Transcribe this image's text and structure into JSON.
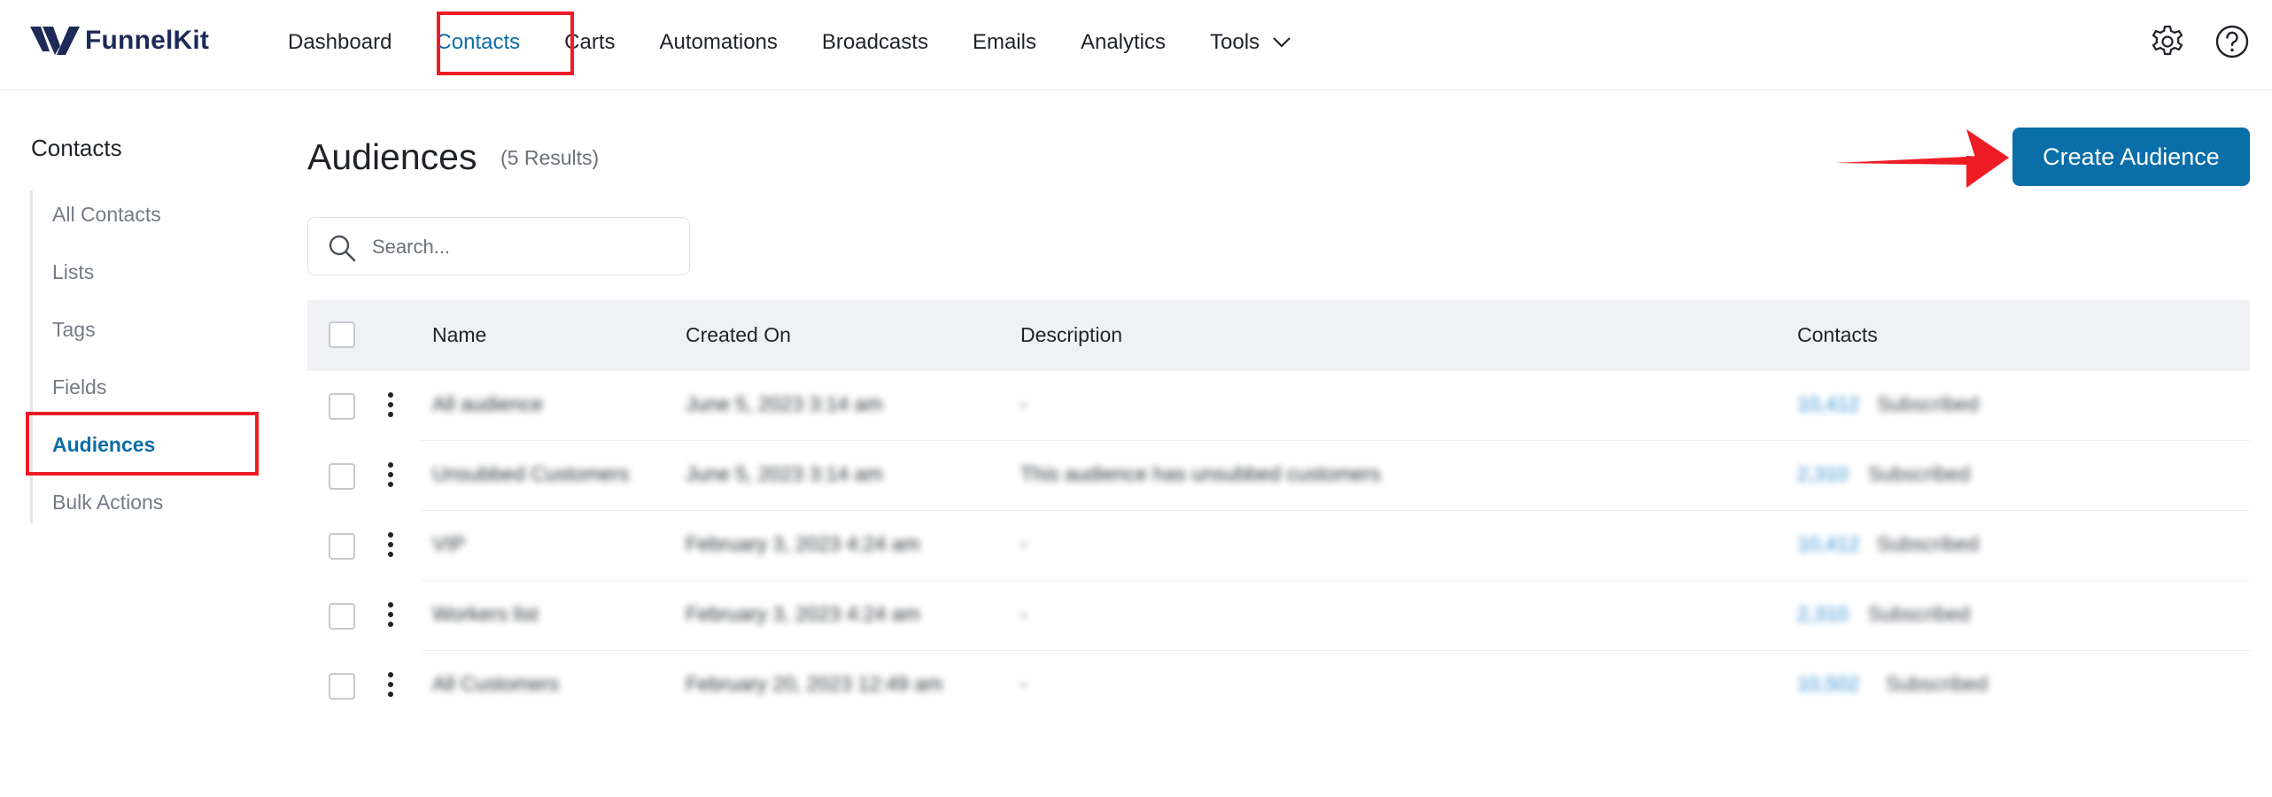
{
  "brand": {
    "name_part1": "Funnel",
    "name_part2": "Kit",
    "accent": "#0a6ea8",
    "highlight": "#ee1c25"
  },
  "nav": {
    "items": [
      {
        "label": "Dashboard"
      },
      {
        "label": "Contacts"
      },
      {
        "label": "Carts"
      },
      {
        "label": "Automations"
      },
      {
        "label": "Broadcasts"
      },
      {
        "label": "Emails"
      },
      {
        "label": "Analytics"
      },
      {
        "label": "Tools"
      }
    ],
    "active": "Contacts",
    "icons": [
      "gear-icon",
      "help-icon"
    ]
  },
  "sidebar": {
    "title": "Contacts",
    "items": [
      {
        "label": "All Contacts"
      },
      {
        "label": "Lists"
      },
      {
        "label": "Tags"
      },
      {
        "label": "Fields"
      },
      {
        "label": "Audiences"
      },
      {
        "label": "Bulk Actions"
      }
    ],
    "active": "Audiences"
  },
  "main": {
    "title": "Audiences",
    "results": "(5 Results)",
    "create_label": "Create Audience",
    "search_placeholder": "Search..."
  },
  "table": {
    "headers": {
      "name": "Name",
      "created": "Created On",
      "description": "Description",
      "contacts": "Contacts"
    },
    "rows": [
      {
        "name": "All audience",
        "created": "June 5, 2023 3:14 am",
        "description": "-",
        "count": "10,412",
        "count_label": "Subscribed"
      },
      {
        "name": "Unsubbed Customers",
        "created": "June 5, 2023 3:14 am",
        "description": "This audience has unsubbed customers",
        "count": "2,310",
        "count_label": "Subscribed"
      },
      {
        "name": "VIP",
        "created": "February 3, 2023 4:24 am",
        "description": "-",
        "count": "10,412",
        "count_label": "Subscribed"
      },
      {
        "name": "Workers list",
        "created": "February 3, 2023 4:24 am",
        "description": "-",
        "count": "2,310",
        "count_label": "Subscribed"
      },
      {
        "name": "All Customers",
        "created": "February 20, 2023 12:49 am",
        "description": "-",
        "count": "10,502",
        "count_label": "Subscribed"
      }
    ]
  }
}
